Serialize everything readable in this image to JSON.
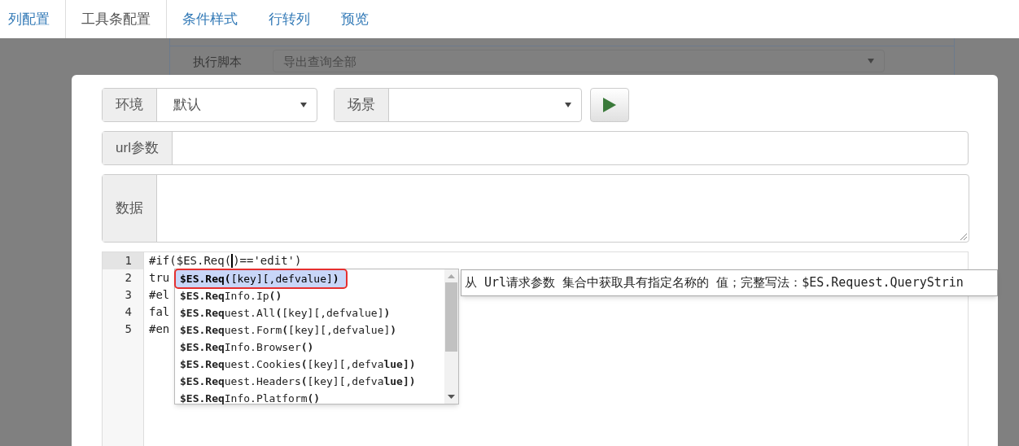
{
  "tabs": [
    {
      "label": "列配置",
      "selected": false
    },
    {
      "label": "工具条配置",
      "selected": true
    },
    {
      "label": "条件样式",
      "selected": false
    },
    {
      "label": "行转列",
      "selected": false
    },
    {
      "label": "预览",
      "selected": false
    }
  ],
  "background": {
    "row_label": "执行脚本",
    "select_value": "导出查询全部"
  },
  "toolbar": {
    "env": {
      "label": "环境",
      "value": "默认"
    },
    "scene": {
      "label": "场景"
    }
  },
  "url_params": {
    "label": "url参数"
  },
  "data": {
    "label": "数据"
  },
  "editor": {
    "lines": [
      {
        "number": "1",
        "text": "#if($ES.Req(",
        "text_after_cursor": ")=='edit')",
        "active": true
      },
      {
        "number": "2",
        "text": "tru",
        "active": false
      },
      {
        "number": "3",
        "text": "#el",
        "active": false
      },
      {
        "number": "4",
        "text": "fal",
        "active": false
      },
      {
        "number": "5",
        "text": "#en",
        "active": false
      }
    ]
  },
  "autocomplete": {
    "items": [
      {
        "text": "**$ES.Req(**[key][,defvalue]**)**",
        "selected": true
      },
      {
        "text": "**$ES.Req**Info.Ip**()**",
        "selected": false
      },
      {
        "text": "**$ES.Req**uest.All**(**[key][,defvalue]**)**",
        "selected": false
      },
      {
        "text": "**$ES.Req**uest.Form**(**[key][,defvalue]**)**",
        "selected": false
      },
      {
        "text": "**$ES.Req**Info.Browser**()**",
        "selected": false
      },
      {
        "text": "**$ES.Req**uest.Cookies**(**[key][,defva**lue])**",
        "selected": false
      },
      {
        "text": "**$ES.Req**uest.Headers**(**[key][,defva**lue])**",
        "selected": false
      },
      {
        "text": "**$ES.Req**Info.Platform**()**",
        "selected": false
      }
    ]
  },
  "tooltip": "从 Url请求参数 集合中获取具有指定名称的 值；完整写法：$ES.Request.QueryStrin"
}
